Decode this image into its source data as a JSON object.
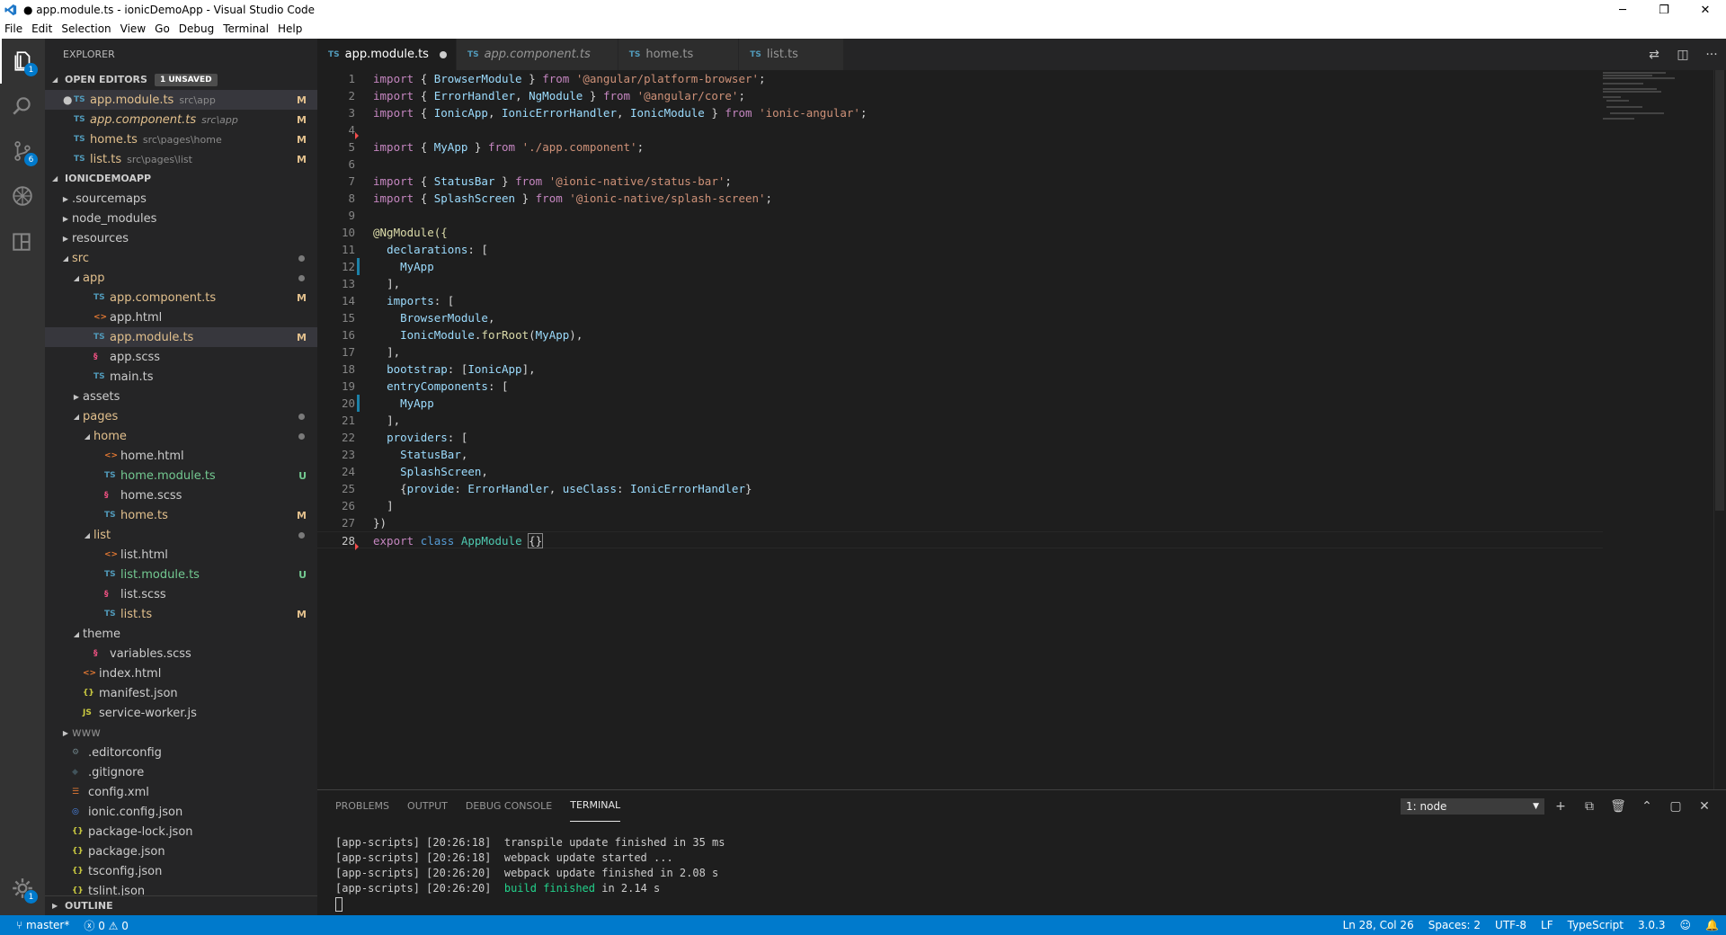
{
  "window": {
    "title": "● app.module.ts - ionicDemoApp - Visual Studio Code",
    "controls": [
      "─",
      "❐",
      "✕"
    ]
  },
  "menu": [
    "File",
    "Edit",
    "Selection",
    "View",
    "Go",
    "Debug",
    "Terminal",
    "Help"
  ],
  "activity": {
    "explorer_badge": "1",
    "scm_badge": "6",
    "settings_badge": "1"
  },
  "sidebar": {
    "title": "EXPLORER",
    "open_editors": {
      "header": "OPEN EDITORS",
      "unsaved": "1 UNSAVED",
      "items": [
        {
          "name": "app.module.ts",
          "path": "src\\app",
          "deco": "M"
        },
        {
          "name": "app.component.ts",
          "path": "src\\app",
          "deco": "M"
        },
        {
          "name": "home.ts",
          "path": "src\\pages\\home",
          "deco": "M"
        },
        {
          "name": "list.ts",
          "path": "src\\pages\\list",
          "deco": "M"
        }
      ]
    },
    "project": {
      "header": "IONICDEMOAPP",
      "items": [
        ".sourcemaps",
        "node_modules",
        "resources",
        "src",
        "app",
        "app.component.ts",
        "app.html",
        "app.module.ts",
        "app.scss",
        "main.ts",
        "assets",
        "pages",
        "home",
        "home.html",
        "home.module.ts",
        "home.scss",
        "home.ts",
        "list",
        "list.html",
        "list.module.ts",
        "list.scss",
        "list.ts",
        "theme",
        "variables.scss",
        "index.html",
        "manifest.json",
        "service-worker.js",
        "www",
        ".editorconfig",
        ".gitignore",
        "config.xml",
        "ionic.config.json",
        "package-lock.json",
        "package.json",
        "tsconfig.json",
        "tslint.json"
      ],
      "deco_m": "M",
      "deco_u": "U"
    },
    "outline": "OUTLINE"
  },
  "icons": {
    "ts": "TS",
    "html": "<>",
    "json": "{}",
    "js": "JS"
  },
  "tabs": [
    {
      "label": "app.module.ts"
    },
    {
      "label": "app.component.ts"
    },
    {
      "label": "home.ts"
    },
    {
      "label": "list.ts"
    }
  ],
  "editor": {
    "line_numbers": [
      "1",
      "2",
      "3",
      "4",
      "5",
      "6",
      "7",
      "8",
      "9",
      "10",
      "11",
      "12",
      "13",
      "14",
      "15",
      "16",
      "17",
      "18",
      "19",
      "20",
      "21",
      "22",
      "23",
      "24",
      "25",
      "26",
      "27",
      "28"
    ],
    "code": {
      "import": "import",
      "from": "from",
      "export": "export",
      "class": "class",
      "ob": "{ ",
      "cb": " }",
      "comma": ", ",
      "semi": ";",
      "BrowserModule": "BrowserModule",
      "ErrorHandler": "ErrorHandler",
      "NgModule": "NgModule",
      "IonicApp": "IonicApp",
      "IonicErrorHandler": "IonicErrorHandler",
      "IonicModule": "IonicModule",
      "MyApp": "MyApp",
      "StatusBar": "StatusBar",
      "SplashScreen": "SplashScreen",
      "AppModule": "AppModule",
      "s_platform": "'@angular/platform-browser'",
      "s_core": "'@angular/core'",
      "s_ionic": "'ionic-angular'",
      "s_component": "'./app.component'",
      "s_statusbar": "'@ionic-native/status-bar'",
      "s_splash": "'@ionic-native/splash-screen'",
      "l10": "@NgModule({",
      "declarations": "declarations",
      "imports": "imports",
      "bootstrap": "bootstrap",
      "entryComponents": "entryComponents",
      "providers": "providers",
      "colon_bracket": ": [",
      "close_arr": "],",
      "close_arr_plain": "]",
      "comma_end": ",",
      "forRoot": "forRoot",
      "dot": ".",
      "paren_open": "(",
      "paren_close_comma": "),",
      "bootstrap_val_open": ": [",
      "bootstrap_val_close": "],",
      "provide_open": "{",
      "provide": "provide",
      "useClass": "useClass",
      "colon": ": ",
      "provide_close": "}",
      "module_close": "})",
      "empty_body": "{}"
    }
  },
  "panel": {
    "tabs": [
      "PROBLEMS",
      "OUTPUT",
      "DEBUG CONSOLE",
      "TERMINAL"
    ],
    "terminal_selector": "1: node",
    "terminal_lines": [
      "[app-scripts] [20:26:18]  transpile update finished in 35 ms",
      "[app-scripts] [20:26:18]  webpack update started ...",
      "[app-scripts] [20:26:20]  webpack update finished in 2.08 s"
    ],
    "last_line_prefix": "[app-scripts] [20:26:20]  ",
    "last_line_ok": "build finished",
    "last_line_suffix": " in 2.14 s",
    "actions": [
      "+",
      "⧉",
      "🗑",
      "⌃",
      "▢",
      "✕"
    ]
  },
  "status": {
    "branch": "master*",
    "errors": "0",
    "warnings": "0",
    "position": "Ln 28, Col 26",
    "spaces": "Spaces: 2",
    "encoding": "UTF-8",
    "eol": "LF",
    "language": "TypeScript",
    "version": "3.0.3"
  },
  "colors": {
    "accent": "#007acc",
    "modified": "#e2c08d",
    "untracked": "#73c991",
    "ts": "#519aba"
  }
}
